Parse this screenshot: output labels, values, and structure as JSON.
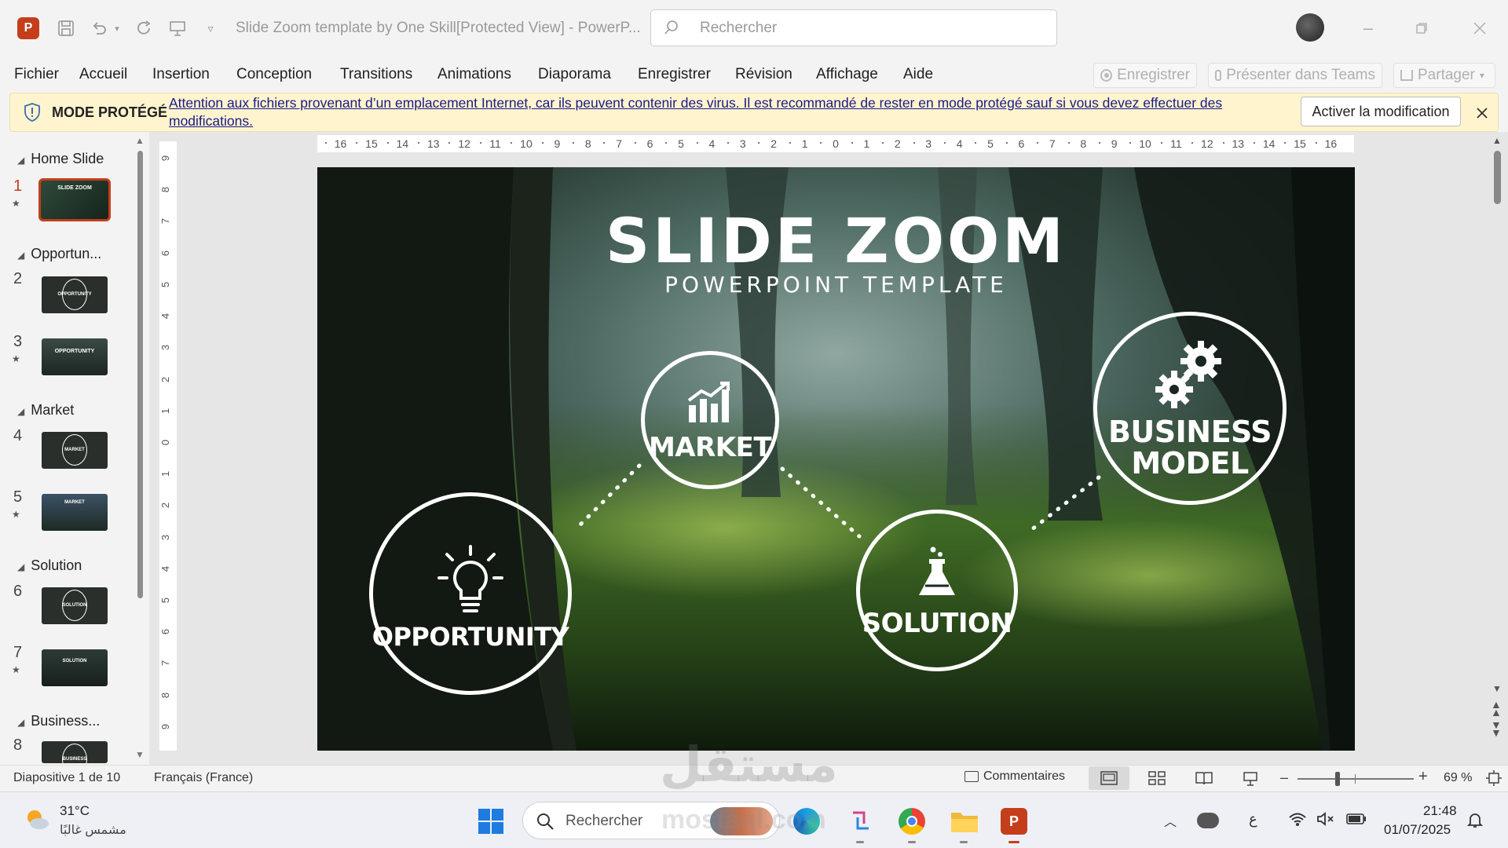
{
  "title_bar": {
    "doc_title": "Slide Zoom template by One Skill[Protected View]  -  PowerP...",
    "search_placeholder": "Rechercher"
  },
  "menu": [
    "Fichier",
    "Accueil",
    "Insertion",
    "Conception",
    "Transitions",
    "Animations",
    "Diaporama",
    "Enregistrer",
    "Révision",
    "Affichage",
    "Aide"
  ],
  "ribbon_right": {
    "record": "Enregistrer",
    "present_teams": "Présenter dans Teams",
    "share": "Partager"
  },
  "protected_bar": {
    "label": "MODE PROTÉGÉ",
    "message_line1": "Attention aux fichiers provenant d’un emplacement Internet, car ils peuvent contenir des virus. Il est recommandé de rester en mode protégé sauf si vous devez effectuer des",
    "message_line2": "modifications.",
    "enable_button": "Activer la modification"
  },
  "thumbnails": {
    "sections": [
      "Home Slide",
      "Opportun...",
      "Market",
      "Solution",
      "Business..."
    ],
    "slides": [
      {
        "num": "1",
        "star": true,
        "caption": "SLIDE ZOOM"
      },
      {
        "num": "2",
        "star": false,
        "caption": "OPPORTUNITY"
      },
      {
        "num": "3",
        "star": true,
        "caption": "OPPORTUNITY"
      },
      {
        "num": "4",
        "star": false,
        "caption": "MARKET"
      },
      {
        "num": "5",
        "star": true,
        "caption": "MARKET"
      },
      {
        "num": "6",
        "star": false,
        "caption": "SOLUTION"
      },
      {
        "num": "7",
        "star": true,
        "caption": "SOLUTION"
      },
      {
        "num": "8",
        "star": false,
        "caption": "BUSINESS"
      }
    ],
    "star_glyph": "★"
  },
  "rulers": {
    "horizontal": [
      "16",
      "15",
      "14",
      "13",
      "12",
      "11",
      "10",
      "9",
      "8",
      "7",
      "6",
      "5",
      "4",
      "3",
      "2",
      "1",
      "0",
      "1",
      "2",
      "3",
      "4",
      "5",
      "6",
      "7",
      "8",
      "9",
      "10",
      "11",
      "12",
      "13",
      "14",
      "15",
      "16"
    ],
    "vertical": [
      "9",
      "8",
      "7",
      "6",
      "5",
      "4",
      "3",
      "2",
      "1",
      "0",
      "1",
      "2",
      "3",
      "4",
      "5",
      "6",
      "7",
      "8",
      "9"
    ]
  },
  "slide": {
    "title": "SLIDE ZOOM",
    "subtitle": "POWERPOINT TEMPLATE",
    "circles": {
      "opportunity": "OPPORTUNITY",
      "market": "MARKET",
      "solution": "SOLUTION",
      "business_line1": "BUSINESS",
      "business_line2": "MODEL"
    }
  },
  "status_bar": {
    "slide_info": "Diapositive 1 de 10",
    "language": "Français (France)",
    "comments": "Commentaires",
    "zoom": "69 %",
    "zoom_level": 0.69
  },
  "taskbar": {
    "weather_temp": "31°C",
    "weather_desc": "مشمس غالبًا",
    "search_placeholder": "Rechercher",
    "ime": "ع",
    "time": "21:48",
    "date": "01/07/2025"
  },
  "colors": {
    "accent_ppt": "#c43e1c",
    "protected_bg": "#fff4ce",
    "link": "#1a1a8a"
  },
  "watermark": {
    "ar": "مستقل",
    "latin": "mostaql.com"
  }
}
